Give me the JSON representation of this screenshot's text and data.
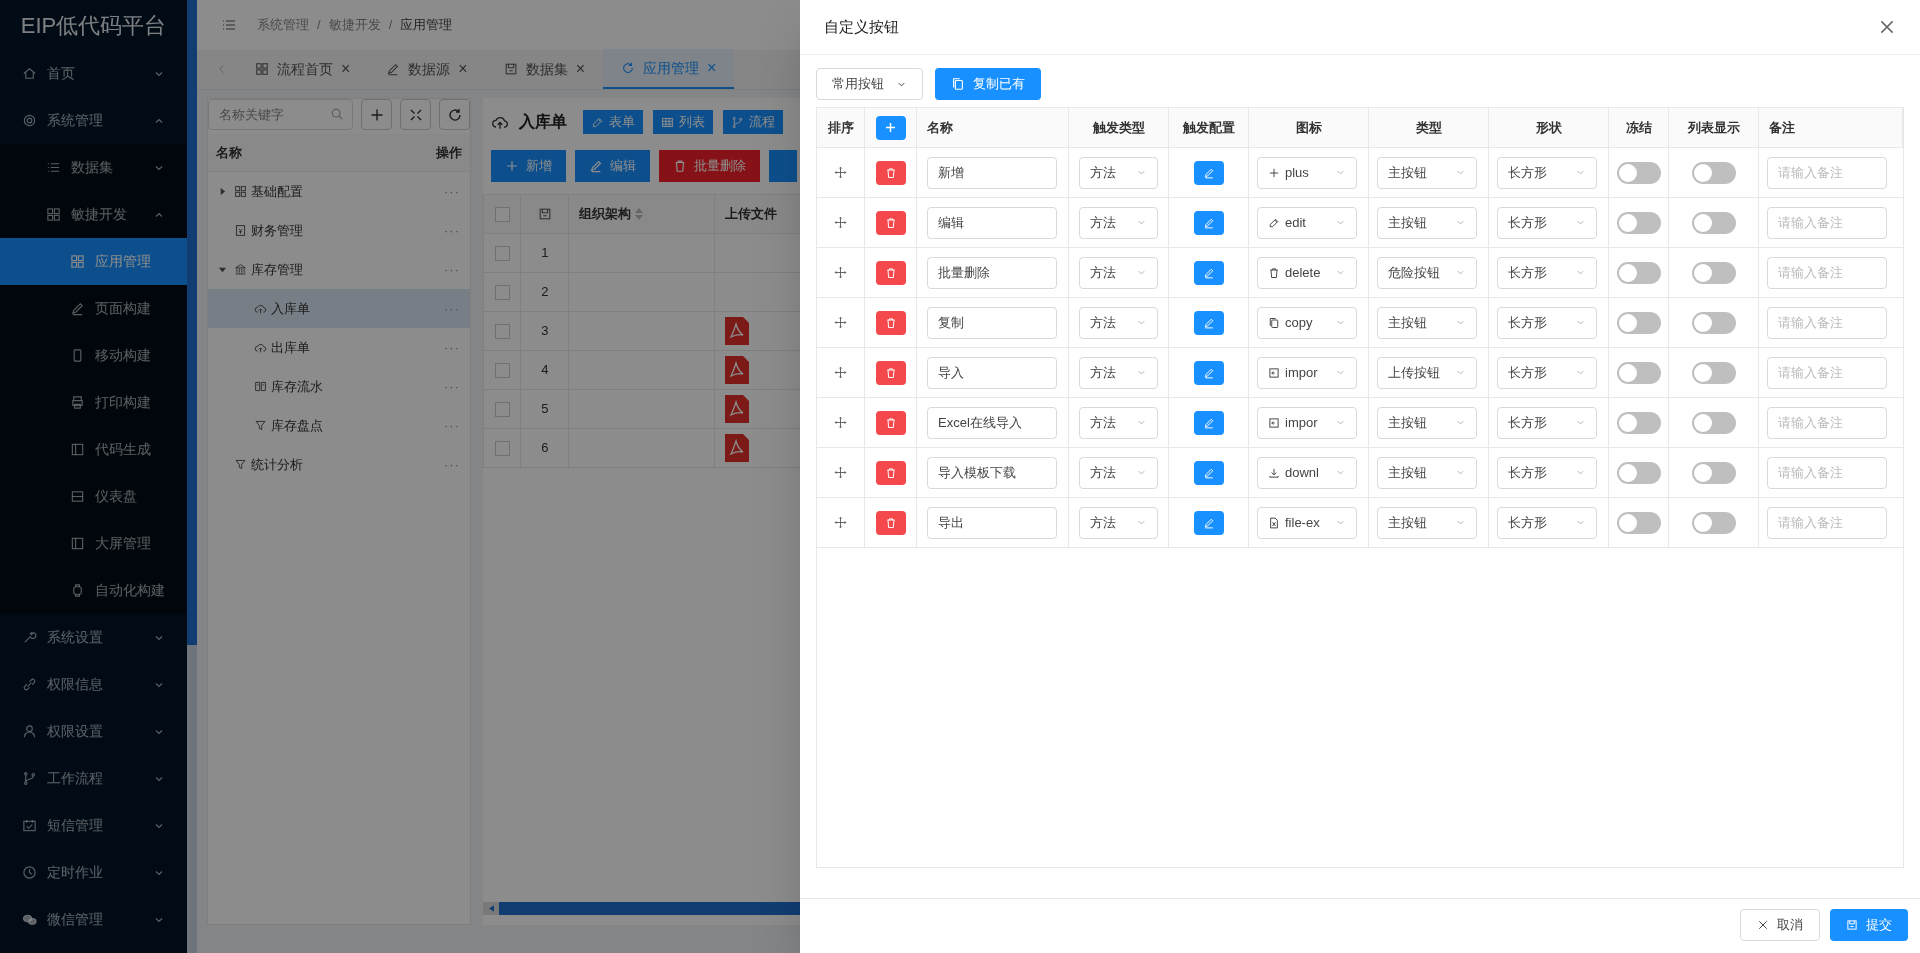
{
  "sidebar": {
    "logo": "EIP低代码平台",
    "items": [
      {
        "label": "首页",
        "expanded": false
      },
      {
        "label": "系统管理",
        "expanded": true,
        "children": [
          {
            "label": "数据集",
            "expanded": false
          },
          {
            "label": "敏捷开发",
            "expanded": true,
            "children": [
              {
                "label": "应用管理",
                "selected": true
              },
              {
                "label": "页面构建",
                "selected": false
              },
              {
                "label": "移动构建",
                "selected": false
              },
              {
                "label": "打印构建",
                "selected": false
              },
              {
                "label": "代码生成",
                "selected": false
              },
              {
                "label": "仪表盘",
                "selected": false
              },
              {
                "label": "大屏管理",
                "selected": false
              },
              {
                "label": "自动化构建",
                "selected": false
              }
            ]
          }
        ]
      },
      {
        "label": "系统设置",
        "expanded": false
      },
      {
        "label": "权限信息",
        "expanded": false
      },
      {
        "label": "权限设置",
        "expanded": false
      },
      {
        "label": "工作流程",
        "expanded": false
      },
      {
        "label": "短信管理",
        "expanded": false
      },
      {
        "label": "定时作业",
        "expanded": false
      },
      {
        "label": "微信管理",
        "expanded": false
      }
    ]
  },
  "breadcrumb": {
    "separator": "/",
    "items": [
      "系统管理",
      "敏捷开发",
      "应用管理"
    ]
  },
  "tabs": [
    {
      "label": "流程首页",
      "close": "×",
      "selected": false
    },
    {
      "label": "数据源",
      "close": "×",
      "selected": false
    },
    {
      "label": "数据集",
      "close": "×",
      "selected": false
    },
    {
      "label": "应用管理",
      "close": "×",
      "selected": true
    }
  ],
  "tree": {
    "search_placeholder": "名称关键字",
    "columns": [
      "名称",
      "操作"
    ],
    "items": [
      {
        "label": "基础配置",
        "expanded": false,
        "selected": false,
        "more": "···"
      },
      {
        "label": "财务管理",
        "selected": false,
        "more": "···"
      },
      {
        "label": "库存管理",
        "expanded": true,
        "selected": false,
        "more": "···",
        "children": [
          {
            "label": "入库单",
            "selected": true,
            "more": "···"
          },
          {
            "label": "出库单",
            "selected": false,
            "more": "···"
          },
          {
            "label": "库存流水",
            "selected": false,
            "more": "···"
          },
          {
            "label": "库存盘点",
            "selected": false,
            "more": "···"
          }
        ]
      },
      {
        "label": "统计分析",
        "selected": false,
        "more": "···"
      }
    ]
  },
  "form": {
    "title": "入库单",
    "view_buttons": [
      "表单",
      "列表",
      "流程"
    ],
    "toolbar": [
      {
        "label": "新增",
        "kind": "primary"
      },
      {
        "label": "编辑",
        "kind": "primary"
      },
      {
        "label": "批量删除",
        "kind": "danger"
      },
      {
        "kind": "primary"
      }
    ],
    "columns": [
      "组织架构",
      "上传文件"
    ],
    "select_all_checked": false,
    "rows": [
      {
        "index": "1",
        "checked": false,
        "file": false
      },
      {
        "index": "2",
        "checked": false,
        "file": false
      },
      {
        "index": "3",
        "checked": false,
        "file": true
      },
      {
        "index": "4",
        "checked": false,
        "file": true
      },
      {
        "index": "5",
        "checked": false,
        "file": true
      },
      {
        "index": "6",
        "checked": false,
        "file": true
      }
    ]
  },
  "drawer": {
    "title": "自定义按钮",
    "preset_select": "常用按钮",
    "copy_button": "复制已有",
    "columns": [
      "排序",
      "名称",
      "触发类型",
      "触发配置",
      "图标",
      "类型",
      "形状",
      "冻结",
      "列表显示",
      "备注"
    ],
    "rows": [
      {
        "name": "新增",
        "trigger": "方法",
        "icon": "plus",
        "type": "主按钮",
        "shape": "长方形",
        "frozen": false,
        "list_display": false,
        "remark_placeholder": "请输入备注"
      },
      {
        "name": "编辑",
        "trigger": "方法",
        "icon": "edit",
        "type": "主按钮",
        "shape": "长方形",
        "frozen": false,
        "list_display": false,
        "remark_placeholder": "请输入备注"
      },
      {
        "name": "批量删除",
        "trigger": "方法",
        "icon": "delete",
        "type": "危险按钮",
        "shape": "长方形",
        "frozen": false,
        "list_display": false,
        "remark_placeholder": "请输入备注"
      },
      {
        "name": "复制",
        "trigger": "方法",
        "icon": "copy",
        "type": "主按钮",
        "shape": "长方形",
        "frozen": false,
        "list_display": false,
        "remark_placeholder": "请输入备注"
      },
      {
        "name": "导入",
        "trigger": "方法",
        "icon": "impor",
        "type": "上传按钮",
        "shape": "长方形",
        "frozen": false,
        "list_display": false,
        "remark_placeholder": "请输入备注"
      },
      {
        "name": "Excel在线导入",
        "trigger": "方法",
        "icon": "impor",
        "type": "主按钮",
        "shape": "长方形",
        "frozen": false,
        "list_display": false,
        "remark_placeholder": "请输入备注"
      },
      {
        "name": "导入模板下载",
        "trigger": "方法",
        "icon": "downl",
        "type": "主按钮",
        "shape": "长方形",
        "frozen": false,
        "list_display": false,
        "remark_placeholder": "请输入备注"
      },
      {
        "name": "导出",
        "trigger": "方法",
        "icon": "file-ex",
        "type": "主按钮",
        "shape": "长方形",
        "frozen": false,
        "list_display": false,
        "remark_placeholder": "请输入备注"
      }
    ],
    "footer": [
      {
        "label": "取消",
        "kind": "default"
      },
      {
        "label": "提交",
        "kind": "primary"
      }
    ]
  }
}
